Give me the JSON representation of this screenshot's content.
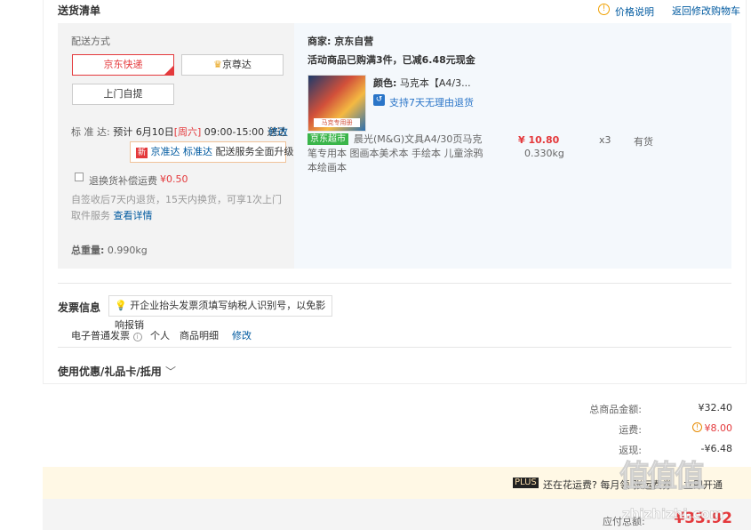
{
  "header": {
    "title": "送货清单",
    "price_note": "价格说明",
    "back_to_cart": "返回修改购物车"
  },
  "delivery": {
    "heading": "配送方式",
    "options": [
      "京东快递",
      "京尊达",
      "上门自提"
    ],
    "schedule_label": "标 准 达:",
    "schedule_text": "预计 6月10日",
    "schedule_day": "[周六]",
    "schedule_time": "09:00-15:00 送达",
    "modify": "修改",
    "upgrade_badge": "新",
    "upgrade_a": "京准达",
    "upgrade_b": "标准达",
    "upgrade_c": "配送服务全面升级",
    "insurance_label": "退换货补偿运费",
    "insurance_price": "¥0.50",
    "insurance_desc": "自签收后7天内退货，15天内换货，可享1次上门取件服务",
    "insurance_more": "查看详情",
    "weight_label": "总重量:",
    "weight_value": "0.990kg"
  },
  "shop": {
    "seller_label": "商家:",
    "seller_name": "京东自营",
    "promo": "活动商品已购满3件，已减6.48元现金",
    "color_label": "颜色:",
    "color_value": "马克本【A4/3...",
    "return_policy": "支持7天无理由退货",
    "product_tag": "京东超市",
    "product_name": "晨光(M&G)文具A4/30页马克笔专用本 图画本美术本 手绘本 儿童涂鸦本绘画本",
    "product_thumb_label": "马克专用册",
    "price": "¥ 10.80",
    "quantity": "x3",
    "stock": "有货",
    "weight": "0.330kg"
  },
  "invoice": {
    "heading": "发票信息",
    "tip": "开企业抬头发票须填写纳税人识别号，以免影响报销",
    "type": "电子普通发票",
    "title": "个人",
    "content": "商品明细",
    "modify": "修改"
  },
  "coupon": {
    "heading": "使用优惠/礼品卡/抵用"
  },
  "summary": {
    "total_label": "总商品金额:",
    "total_value": "¥32.40",
    "shipping_label": "运费:",
    "shipping_value": "¥8.00",
    "rebate_label": "返现:",
    "rebate_value": "-¥6.48",
    "plus_badge": "PLUS",
    "plus_text": "还在花运费? 每月领",
    "plus_partial": "张运费券",
    "plus_cta": "立即开通",
    "payable_label": "应付总额:",
    "payable_value": "¥33.92"
  },
  "watermark": {
    "brand": "值值值",
    "url": "zhizhizhi.com"
  },
  "colors": {
    "accent_red": "#e4393c",
    "link_blue": "#005aa0",
    "tag_green": "#3ab54a",
    "pane_gray": "#f3f3f3",
    "pane_blue": "#f4f8fc"
  }
}
